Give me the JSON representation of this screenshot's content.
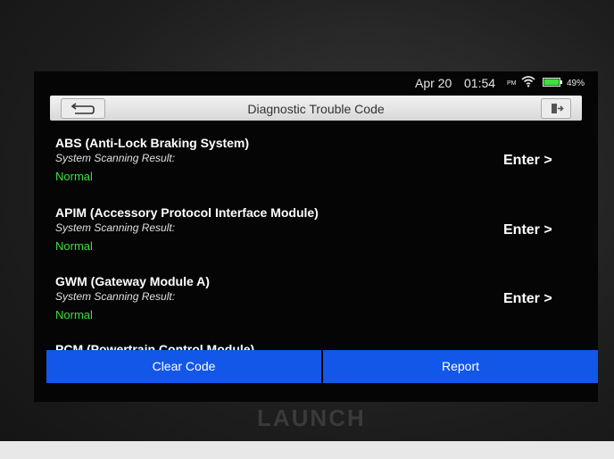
{
  "status_bar": {
    "date": "Apr 20",
    "time": "01:54",
    "ampm": "PM",
    "battery_percent": "49%"
  },
  "title_bar": {
    "title": "Diagnostic Trouble Code"
  },
  "modules": [
    {
      "name": "ABS (Anti-Lock Braking System)",
      "scan_label": "System Scanning Result:",
      "result": "Normal",
      "enter_label": "Enter >"
    },
    {
      "name": "APIM (Accessory Protocol Interface Module)",
      "scan_label": "System Scanning Result:",
      "result": "Normal",
      "enter_label": "Enter >"
    },
    {
      "name": "GWM (Gateway Module A)",
      "scan_label": "System Scanning Result:",
      "result": "Normal",
      "enter_label": "Enter >"
    },
    {
      "name": "PCM (Powertrain Control Module)"
    }
  ],
  "actions": {
    "clear_label": "Clear Code",
    "report_label": "Report"
  },
  "brand": "LAUNCH",
  "colors": {
    "normal_status": "#36e03a",
    "action_button": "#1257e8"
  }
}
